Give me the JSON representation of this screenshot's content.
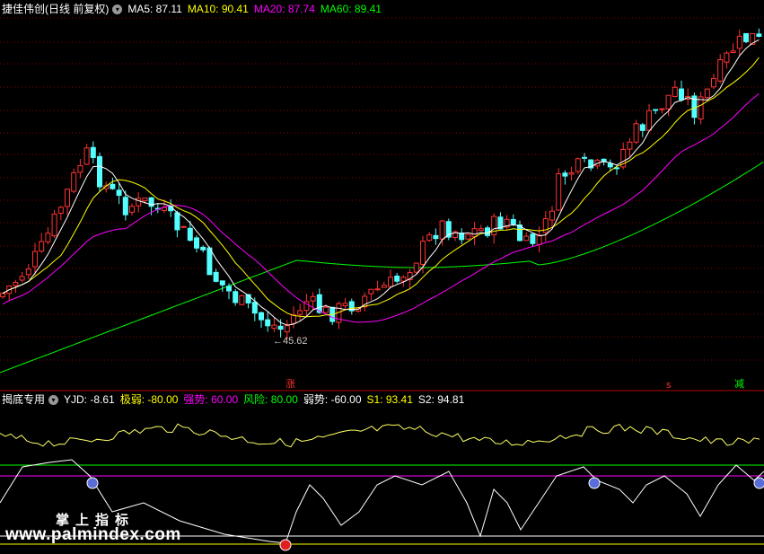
{
  "main_header": {
    "title": "捷佳伟创(日线 前复权)",
    "ma5": "MA5: 87.11",
    "ma10": "MA10: 90.41",
    "ma20": "MA20: 87.74",
    "ma60": "MA60: 89.41"
  },
  "sub_header": {
    "title": "揭底专用",
    "yjd": "YJD: -8.61",
    "jiruo": "极弱: -80.00",
    "qiangshi": "强势: 60.00",
    "fengxian": "风险: 80.00",
    "ruoshi": "弱势: -60.00",
    "s1": "S1: 93.41",
    "s2": "S2: 94.81"
  },
  "low_marker": "←45.62",
  "markers": {
    "zhang": "涨",
    "jian": "减",
    "duo": "多"
  },
  "watermark": {
    "cn": "掌上指标",
    "url": "www.palmindex.com"
  },
  "colors": {
    "up": "#ff3232",
    "down": "#54ffff",
    "ma5": "#ffffff",
    "ma10": "#ffff00",
    "ma20": "#ff00ff",
    "ma60": "#00ff00",
    "grid": "#8b0000"
  }
}
